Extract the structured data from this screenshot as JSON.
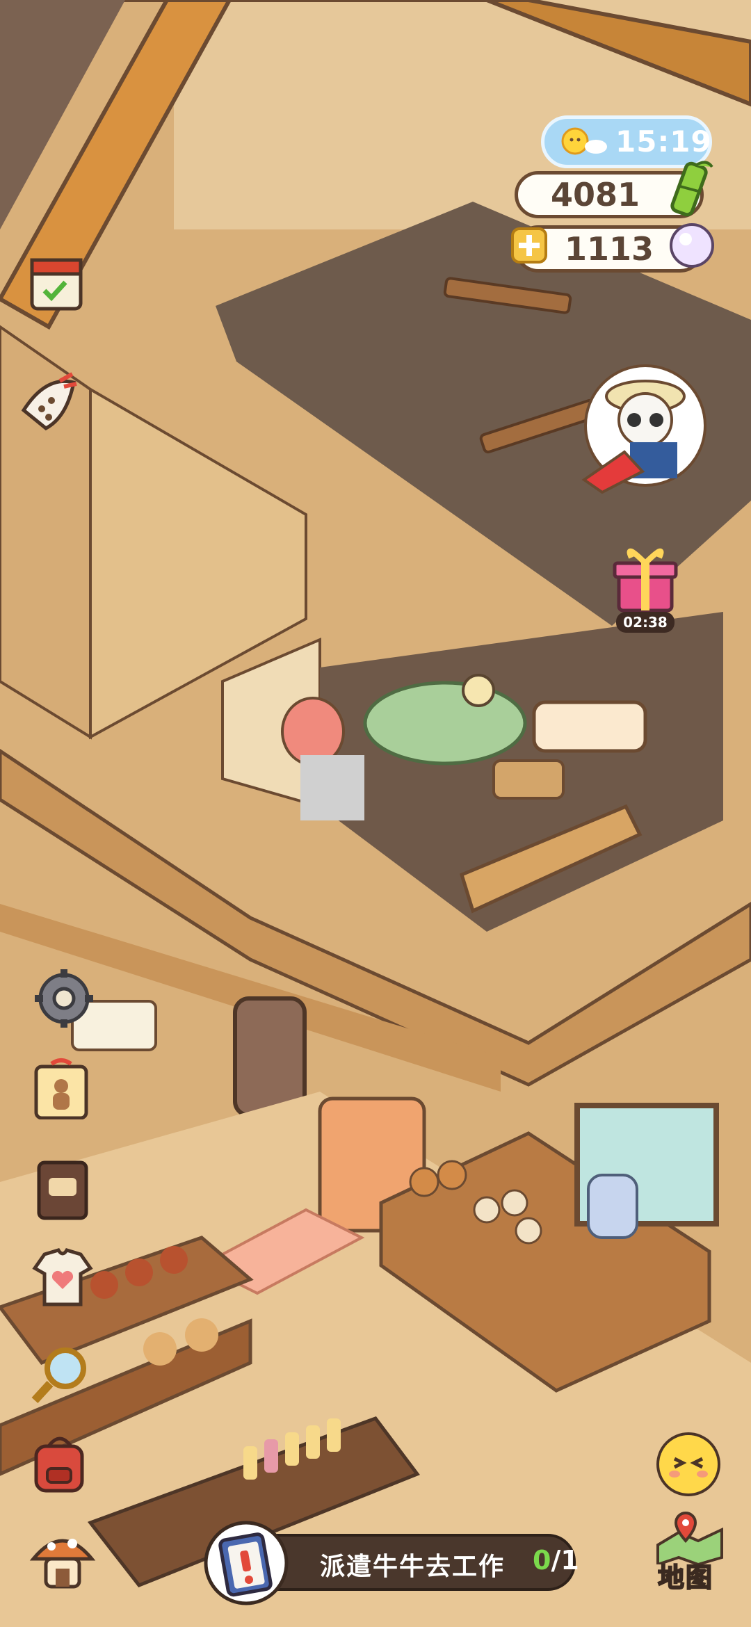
{
  "status": {
    "time": "15:19",
    "coins": "4081",
    "pearls": "1113"
  },
  "gift": {
    "timer": "02:38"
  },
  "task": {
    "text": "派遣牛牛去工作",
    "done": "0",
    "total": "/1"
  },
  "map": {
    "label": "地图"
  },
  "colors": {
    "wall": "#d9b07a",
    "floor_dark": "#6e5b4c",
    "roof_tile": "#d99240",
    "outline": "#6b4a31",
    "progress_done": "#7bd94c"
  },
  "icons": {
    "calendar": "calendar-icon",
    "shell": "shell-icon",
    "settings": "gear-icon",
    "gingerbread": "gingerbread-tag-icon",
    "recipe_book": "recipe-book-icon",
    "outfit": "shirt-heart-icon",
    "search": "magnifier-icon",
    "backpack": "backpack-icon",
    "shop": "mushroom-shop-icon",
    "emote": "smiley-face-icon",
    "map": "map-pin-icon",
    "bamboo": "bamboo-icon",
    "pearl": "pearl-icon",
    "plus": "plus-icon",
    "gift": "gift-box-icon",
    "npc": "panda-farmer-avatar",
    "task": "clipboard-alert-icon"
  }
}
